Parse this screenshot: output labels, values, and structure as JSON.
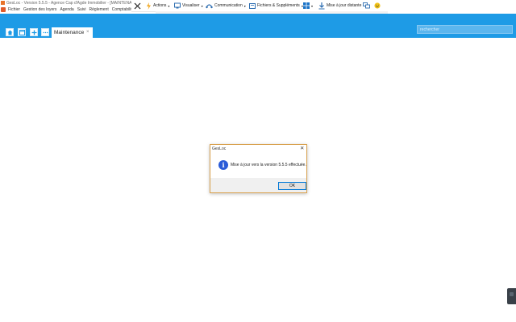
{
  "window": {
    "title": "GesLoc - Version 5.5.5 - Agence Cap d'Agde Immobilier - [MAINTENANCE]"
  },
  "menu": {
    "items": [
      "Fichier",
      "Gestion des loyers",
      "Agenda",
      "Suivi",
      "Règlement",
      "Comptabilité"
    ]
  },
  "toolbar": {
    "actions": "Actions",
    "visualiser": "Visualiser",
    "communication": "Communication",
    "fichiers": "Fichiers & Suppléments",
    "update": "Mise à jour distante"
  },
  "tabs": {
    "active_label": "Maintenance",
    "close_glyph": "×"
  },
  "search": {
    "placeholder": "rechercher"
  },
  "dialog": {
    "title": "GesLoc",
    "message": "Mise à jour vers la version 5.5.5 effectuée.",
    "ok_label": "OK",
    "close_glyph": "✕",
    "icon_glyph": "i"
  },
  "colors": {
    "accent": "#1e9be6",
    "dialog_border": "#d9a24f",
    "info_icon": "#2a5bd7"
  },
  "icons": [
    "app-icon",
    "close-x-icon",
    "actions-icon",
    "visualiser-icon",
    "communication-icon",
    "fichiers-icon",
    "windows-icon",
    "download-icon",
    "screens-icon",
    "smiley-icon",
    "home-icon",
    "window-icon",
    "plus-icon",
    "more-icon",
    "info-icon"
  ]
}
